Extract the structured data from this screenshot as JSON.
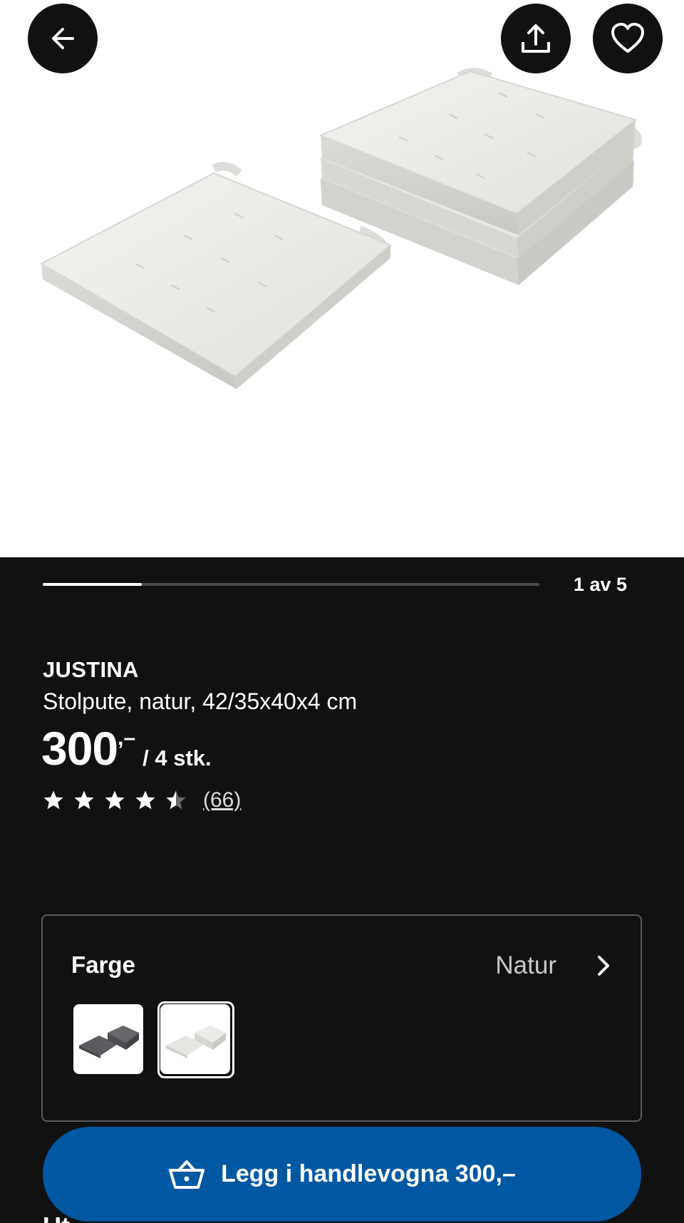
{
  "header": {
    "back_icon": "arrow-left-icon",
    "share_icon": "share-upload-icon",
    "favourite_icon": "heart-icon"
  },
  "gallery": {
    "current": 1,
    "total": 5,
    "progress": 0.2,
    "counter_label": "1 av 5"
  },
  "product": {
    "name": "JUSTINA",
    "description": "Stolpute, natur, 42/35x40x4 cm",
    "price_integer": "300",
    "price_decimals": ",–",
    "price_unit": "/ 4 stk.",
    "rating": 4.5,
    "rating_max": 5,
    "review_count": "(66)"
  },
  "color_selector": {
    "label": "Farge",
    "selected_value": "Natur",
    "options": [
      "grey",
      "natur"
    ],
    "selected_index": 1
  },
  "cart": {
    "label": "Legg i handlevogna 300,–",
    "icon": "basket-icon",
    "button_color": "#0058a3"
  },
  "below_fold_peek": "Ut"
}
